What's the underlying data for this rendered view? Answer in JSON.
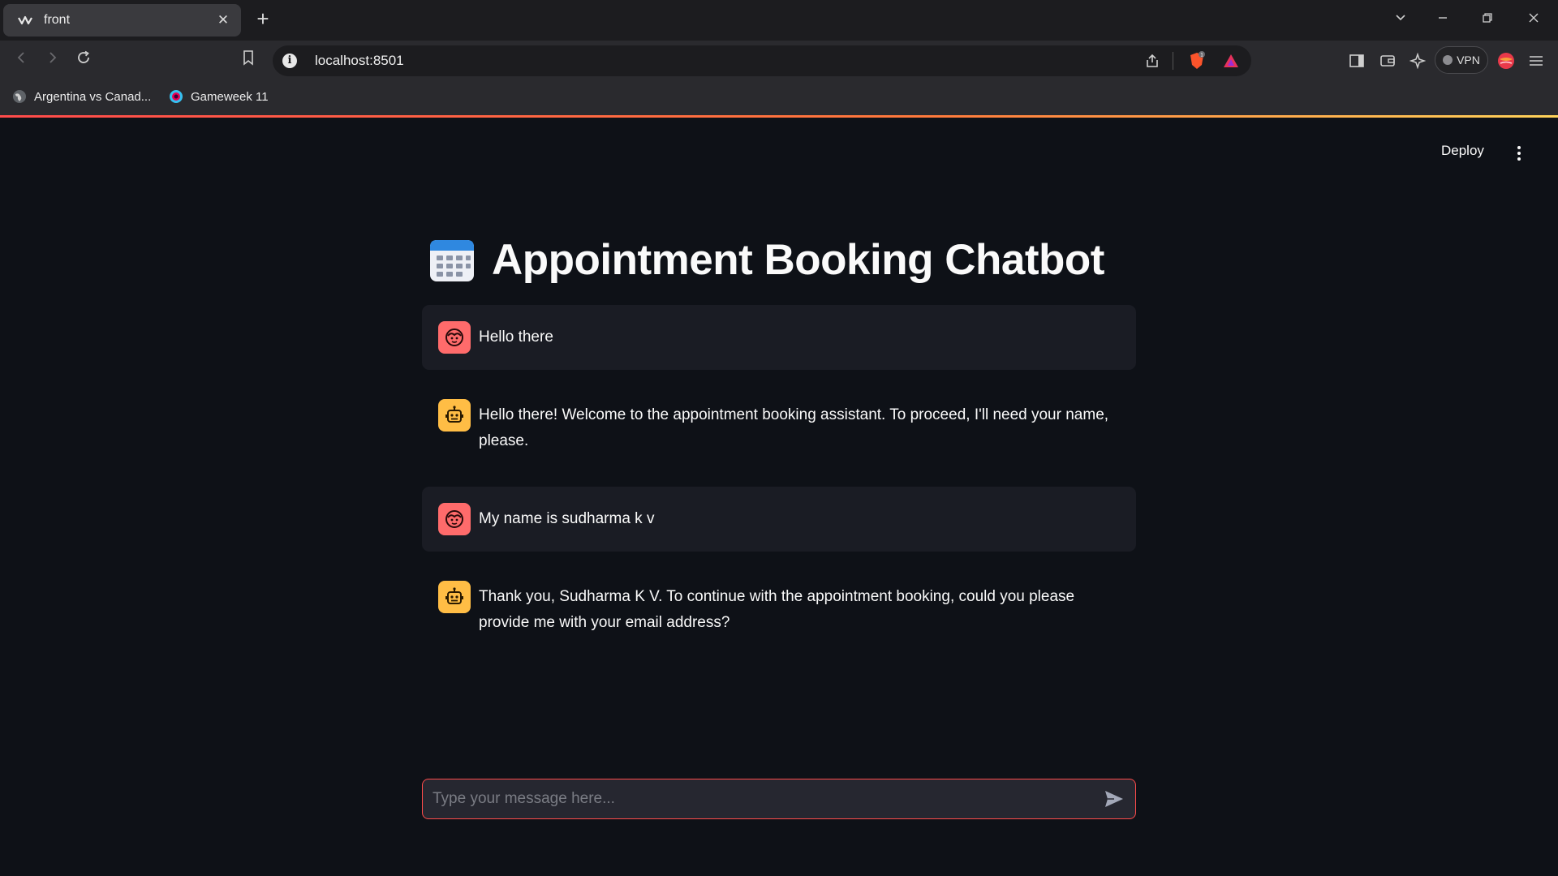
{
  "browser": {
    "tab_title": "front",
    "tab_close": "✕",
    "new_tab": "+",
    "url": "localhost:8501",
    "url_info": "i",
    "vpn_label": "VPN",
    "bookmarks": [
      {
        "label": "Argentina vs Canad..."
      },
      {
        "label": "Gameweek 11"
      }
    ]
  },
  "header": {
    "deploy_label": "Deploy"
  },
  "page": {
    "title": "Appointment Booking Chatbot"
  },
  "messages": [
    {
      "role": "user",
      "text": "Hello there"
    },
    {
      "role": "assistant",
      "text": "Hello there! Welcome to the appointment booking assistant. To proceed, I'll need your name, please."
    },
    {
      "role": "user",
      "text": "My name is sudharma k v"
    },
    {
      "role": "assistant",
      "text": "Thank you, Sudharma K V. To continue with the appointment booking, could you please provide me with your email address?"
    }
  ],
  "chat_input": {
    "placeholder": "Type your message here..."
  },
  "colors": {
    "background": "#0e1117",
    "user_bubble": "#1a1c24",
    "user_avatar": "#ff6b6b",
    "bot_avatar": "#ffbd45",
    "accent": "#ff4b4b"
  }
}
